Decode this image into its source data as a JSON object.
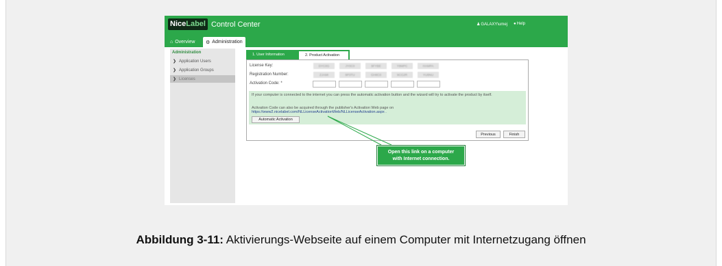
{
  "app": {
    "logo_nice": "Nice",
    "logo_label": "Label",
    "title": "Control Center",
    "user": "GALAXY\\umej",
    "help": "Help"
  },
  "tabs": [
    {
      "label": "Overview",
      "icon": "home-icon"
    },
    {
      "label": "Administration",
      "icon": "gears-icon"
    }
  ],
  "sidebar": {
    "title": "Administration",
    "items": [
      {
        "label": "Application Users"
      },
      {
        "label": "Application Groups"
      },
      {
        "label": "Licenses",
        "active": true
      }
    ]
  },
  "wizard": {
    "tabs": [
      {
        "label": "1. User Information"
      },
      {
        "label": "2. Product Activation",
        "active": true
      }
    ],
    "license_key_label": "License Key:",
    "license_key_parts": [
      "DYC0G",
      "JY0C0",
      "9FYBE",
      "Y8MPC",
      "HAMPA"
    ],
    "registration_label": "Registration Number:",
    "registration_parts": [
      "ZJAMI",
      "9P3TU",
      "GH8C0",
      "9CG2R",
      "YU8NU"
    ],
    "activation_label": "Activation Code: *",
    "info_text": "If your computer is connected to the internet you can press the automatic activation button and the wizard will try to activate the product by itself.",
    "acquire_text": "Activation Code can also be acquired through the publisher's Activation Web page on",
    "activation_url": "https://www2.nicelabel.com/NLLicenseActivationWeb/NLLicenseActivation.aspx .",
    "auto_button": "Automatic Activation",
    "previous_button": "Previous",
    "finish_button": "Finish"
  },
  "callout": {
    "line1": "Open this link on a computer",
    "line2": "with Internet connection."
  },
  "caption": {
    "label": "Abbildung 3-11:",
    "text": "Aktivierungs-Webseite auf einem Computer mit Internetzugang öffnen"
  },
  "colors": {
    "brand_green": "#2ca84a",
    "info_box": "#d5eed8",
    "link": "#233f8f"
  }
}
